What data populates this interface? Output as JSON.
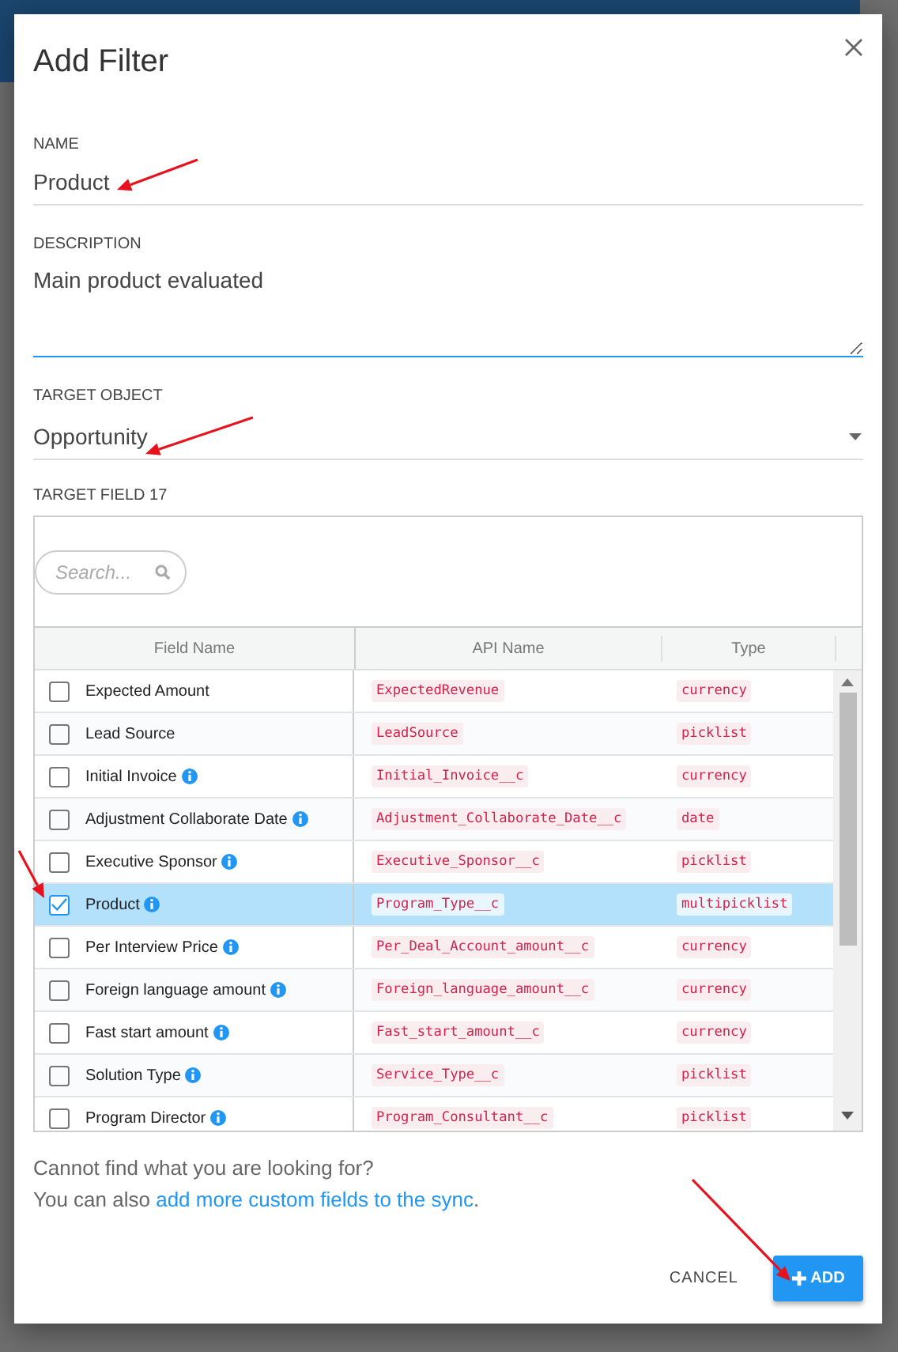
{
  "dialog": {
    "title": "Add Filter"
  },
  "fields": [
    {
      "kind": "input",
      "label": "NAME",
      "value": "Product"
    },
    {
      "kind": "textarea",
      "label": "DESCRIPTION",
      "value": "Main product evaluated"
    },
    {
      "kind": "select",
      "label": "TARGET OBJECT",
      "value": "Opportunity"
    }
  ],
  "target_field": {
    "label": "TARGET FIELD 17",
    "search": {
      "placeholder": "Search..."
    },
    "columns": [
      "Field Name",
      "API Name",
      "Type"
    ],
    "rows": [
      {
        "field_name": "Expected Amount",
        "info": false,
        "api_name": "ExpectedRevenue",
        "type": "currency",
        "checked": false,
        "selected": false
      },
      {
        "field_name": "Lead Source",
        "info": false,
        "api_name": "LeadSource",
        "type": "picklist",
        "checked": false,
        "selected": false
      },
      {
        "field_name": "Initial Invoice",
        "info": true,
        "api_name": "Initial_Invoice__c",
        "type": "currency",
        "checked": false,
        "selected": false
      },
      {
        "field_name": "Adjustment Collaborate Date",
        "info": true,
        "api_name": "Adjustment_Collaborate_Date__c",
        "type": "date",
        "checked": false,
        "selected": false
      },
      {
        "field_name": "Executive Sponsor",
        "info": true,
        "api_name": "Executive_Sponsor__c",
        "type": "picklist",
        "checked": false,
        "selected": false
      },
      {
        "field_name": "Product",
        "info": true,
        "api_name": "Program_Type__c",
        "type": "multipicklist",
        "checked": true,
        "selected": true
      },
      {
        "field_name": "Per Interview Price",
        "info": true,
        "api_name": "Per_Deal_Account_amount__c",
        "type": "currency",
        "checked": false,
        "selected": false
      },
      {
        "field_name": "Foreign language amount",
        "info": true,
        "api_name": "Foreign_language_amount__c",
        "type": "currency",
        "checked": false,
        "selected": false
      },
      {
        "field_name": "Fast start amount",
        "info": true,
        "api_name": "Fast_start_amount__c",
        "type": "currency",
        "checked": false,
        "selected": false
      },
      {
        "field_name": "Solution Type",
        "info": true,
        "api_name": "Service_Type__c",
        "type": "picklist",
        "checked": false,
        "selected": false
      },
      {
        "field_name": "Program Director",
        "info": true,
        "api_name": "Program_Consultant__c",
        "type": "picklist",
        "checked": false,
        "selected": false
      }
    ]
  },
  "help": {
    "line1": "Cannot find what you are looking for?",
    "line2_prefix": "You can also ",
    "link": "add more custom fields to the sync",
    "line2_suffix": "."
  },
  "buttons": [
    {
      "kind": "text",
      "label": "CANCEL"
    },
    {
      "kind": "primary",
      "label": "ADD"
    }
  ]
}
